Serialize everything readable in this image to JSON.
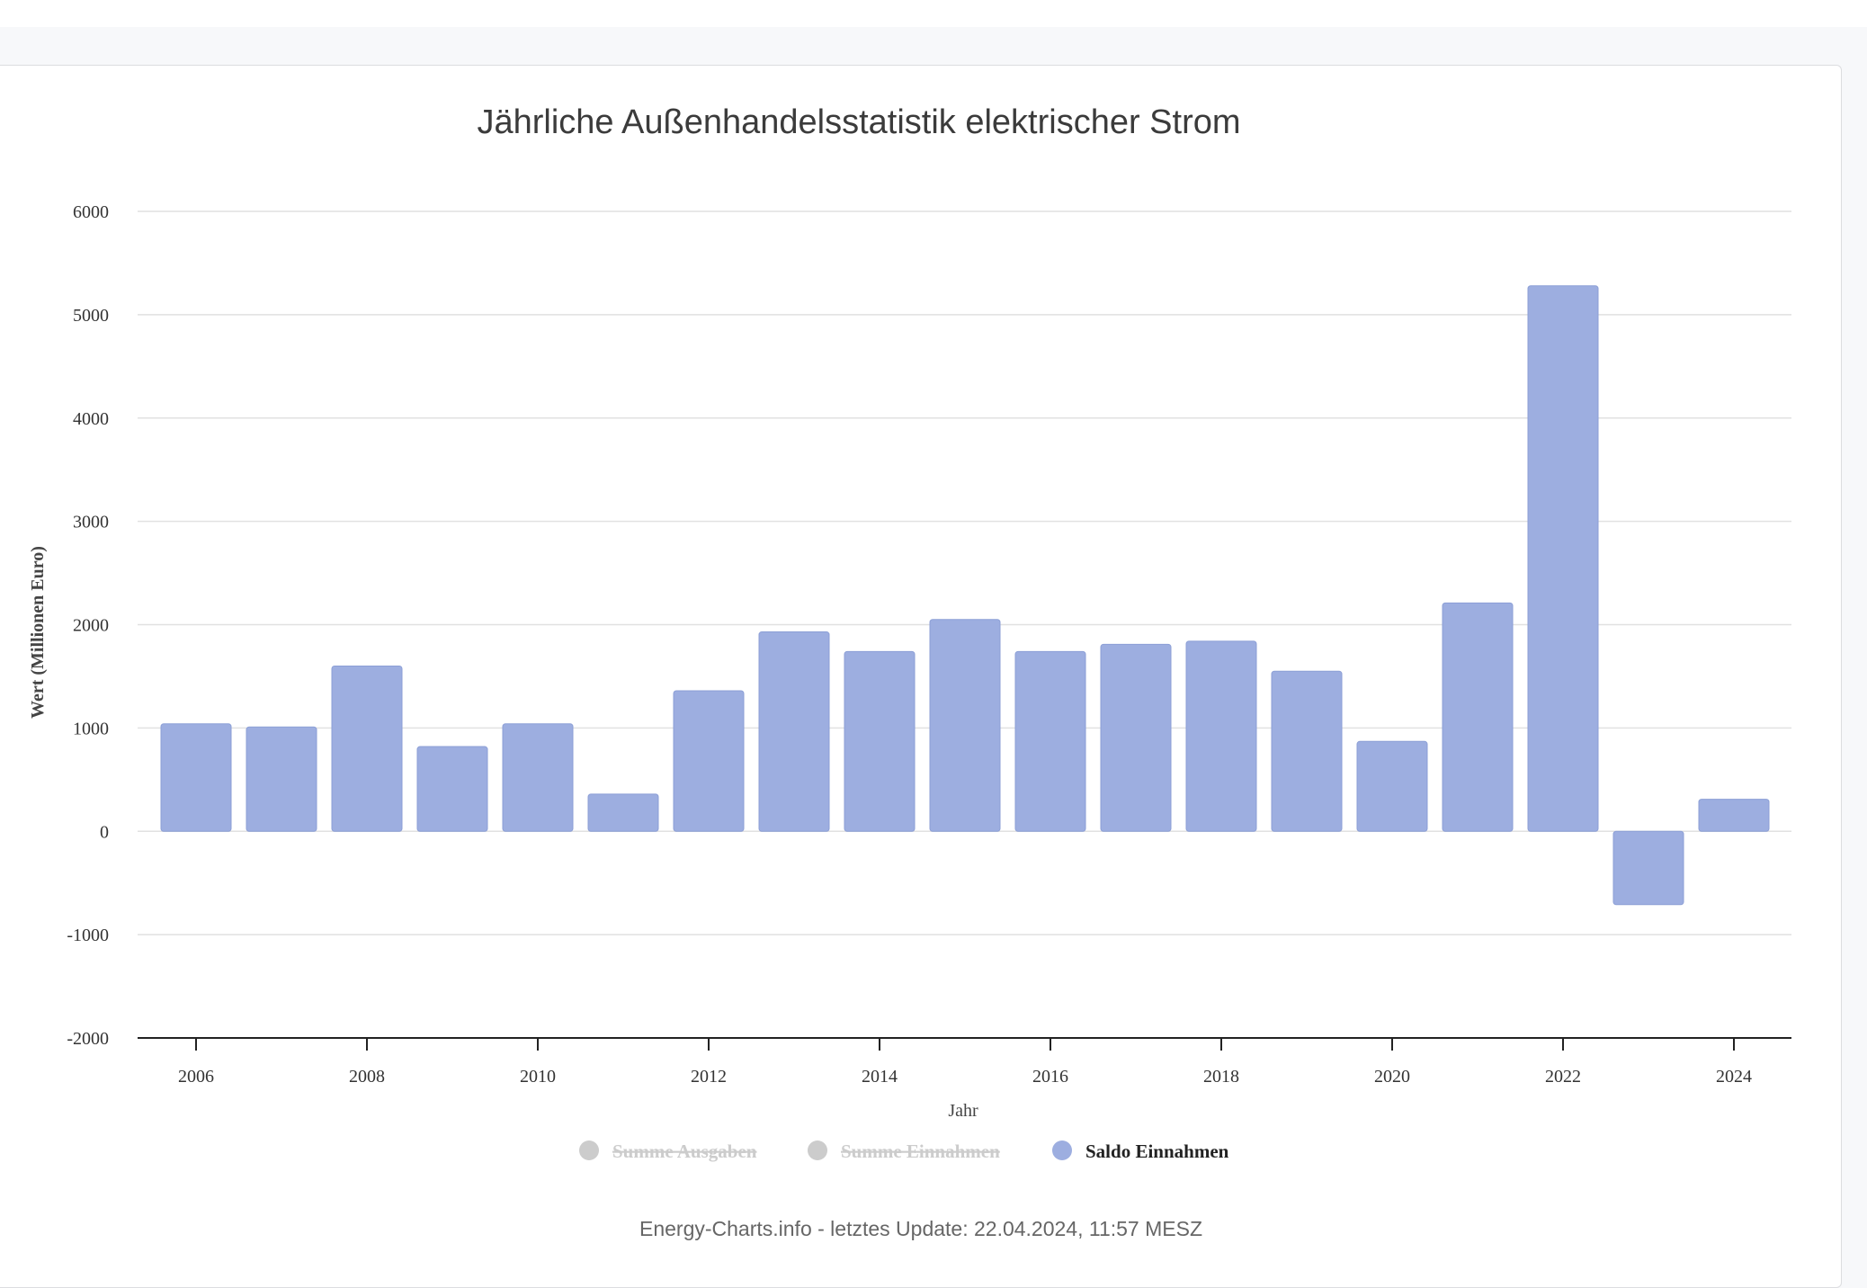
{
  "colors": {
    "bar": "#9daee0",
    "bar_stroke": "#8c9fd6",
    "grid": "#e1e1e1",
    "axis": "#222222",
    "legend_inactive": "#cccccc",
    "legend_active_text": "#222222"
  },
  "chart_data": {
    "type": "bar",
    "title": "Jährliche Außenhandelsstatistik elektrischer Strom",
    "xlabel": "Jahr",
    "ylabel": "Wert (Millionen Euro)",
    "ylim": [
      -2000,
      6000
    ],
    "yticks": [
      6000,
      5000,
      4000,
      3000,
      2000,
      1000,
      0,
      -1000,
      -2000
    ],
    "xtick_labels": [
      "2006",
      "2008",
      "2010",
      "2012",
      "2014",
      "2016",
      "2018",
      "2020",
      "2022",
      "2024"
    ],
    "categories": [
      2006,
      2007,
      2008,
      2009,
      2010,
      2011,
      2012,
      2013,
      2014,
      2015,
      2016,
      2017,
      2018,
      2019,
      2020,
      2021,
      2022,
      2023,
      2024
    ],
    "series": [
      {
        "name": "Saldo Einnahmen",
        "values": [
          1040,
          1010,
          1600,
          820,
          1040,
          360,
          1360,
          1930,
          1740,
          2050,
          1740,
          1810,
          1840,
          1550,
          870,
          2210,
          5280,
          -710,
          310
        ]
      }
    ],
    "grid": true,
    "legend": {
      "placement": "bottom-center",
      "items": [
        {
          "label": "Summe Ausgaben",
          "active": false
        },
        {
          "label": "Summe Einnahmen",
          "active": false
        },
        {
          "label": "Saldo Einnahmen",
          "active": true
        }
      ]
    }
  },
  "credit": "Energy-Charts.info - letztes Update: 22.04.2024, 11:57 MESZ"
}
